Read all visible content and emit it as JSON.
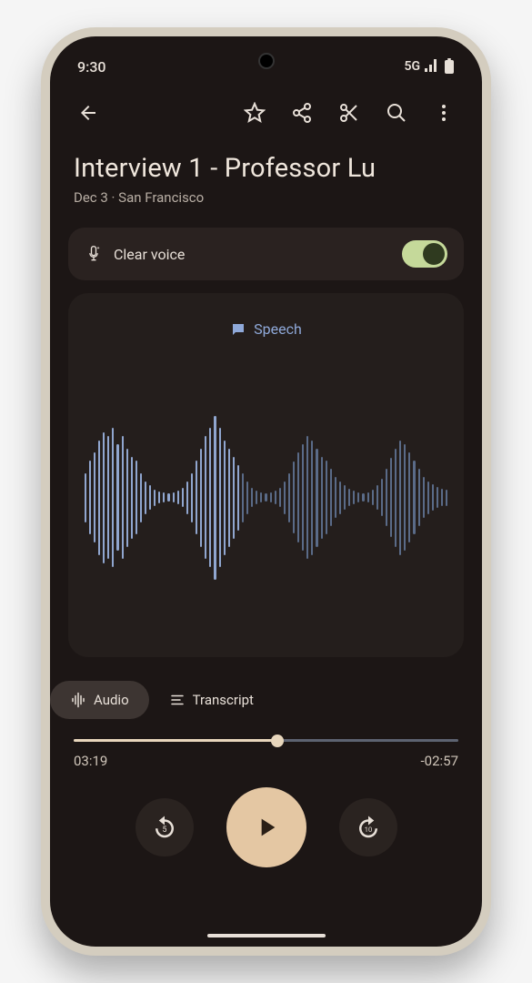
{
  "status": {
    "time": "9:30",
    "network": "5G"
  },
  "title": "Interview 1 - Professor Lu",
  "subtitle": "Dec 3 · San Francisco",
  "clear_voice": {
    "label": "Clear voice",
    "enabled": true
  },
  "speech_label": "Speech",
  "tabs": {
    "audio": "Audio",
    "transcript": "Transcript"
  },
  "playback": {
    "elapsed": "03:19",
    "remaining": "-02:57",
    "progress_pct": 53,
    "rewind_seconds": "5",
    "forward_seconds": "10"
  },
  "colors": {
    "accent": "#e4c7a3",
    "wave": "#90a6cf",
    "wave_dim": "#5a6b88",
    "toggle_on": "#c5d99a"
  },
  "waveform_heights": [
    60,
    90,
    110,
    140,
    160,
    150,
    170,
    130,
    150,
    120,
    100,
    90,
    60,
    40,
    30,
    20,
    14,
    12,
    10,
    12,
    16,
    24,
    40,
    60,
    90,
    120,
    150,
    170,
    200,
    170,
    140,
    120,
    100,
    80,
    60,
    40,
    24,
    16,
    12,
    10,
    12,
    16,
    24,
    40,
    60,
    88,
    110,
    130,
    150,
    140,
    120,
    100,
    90,
    70,
    50,
    40,
    30,
    22,
    16,
    12,
    10,
    12,
    18,
    30,
    46,
    70,
    96,
    120,
    140,
    130,
    110,
    90,
    70,
    50,
    40,
    32,
    26,
    22,
    20
  ]
}
